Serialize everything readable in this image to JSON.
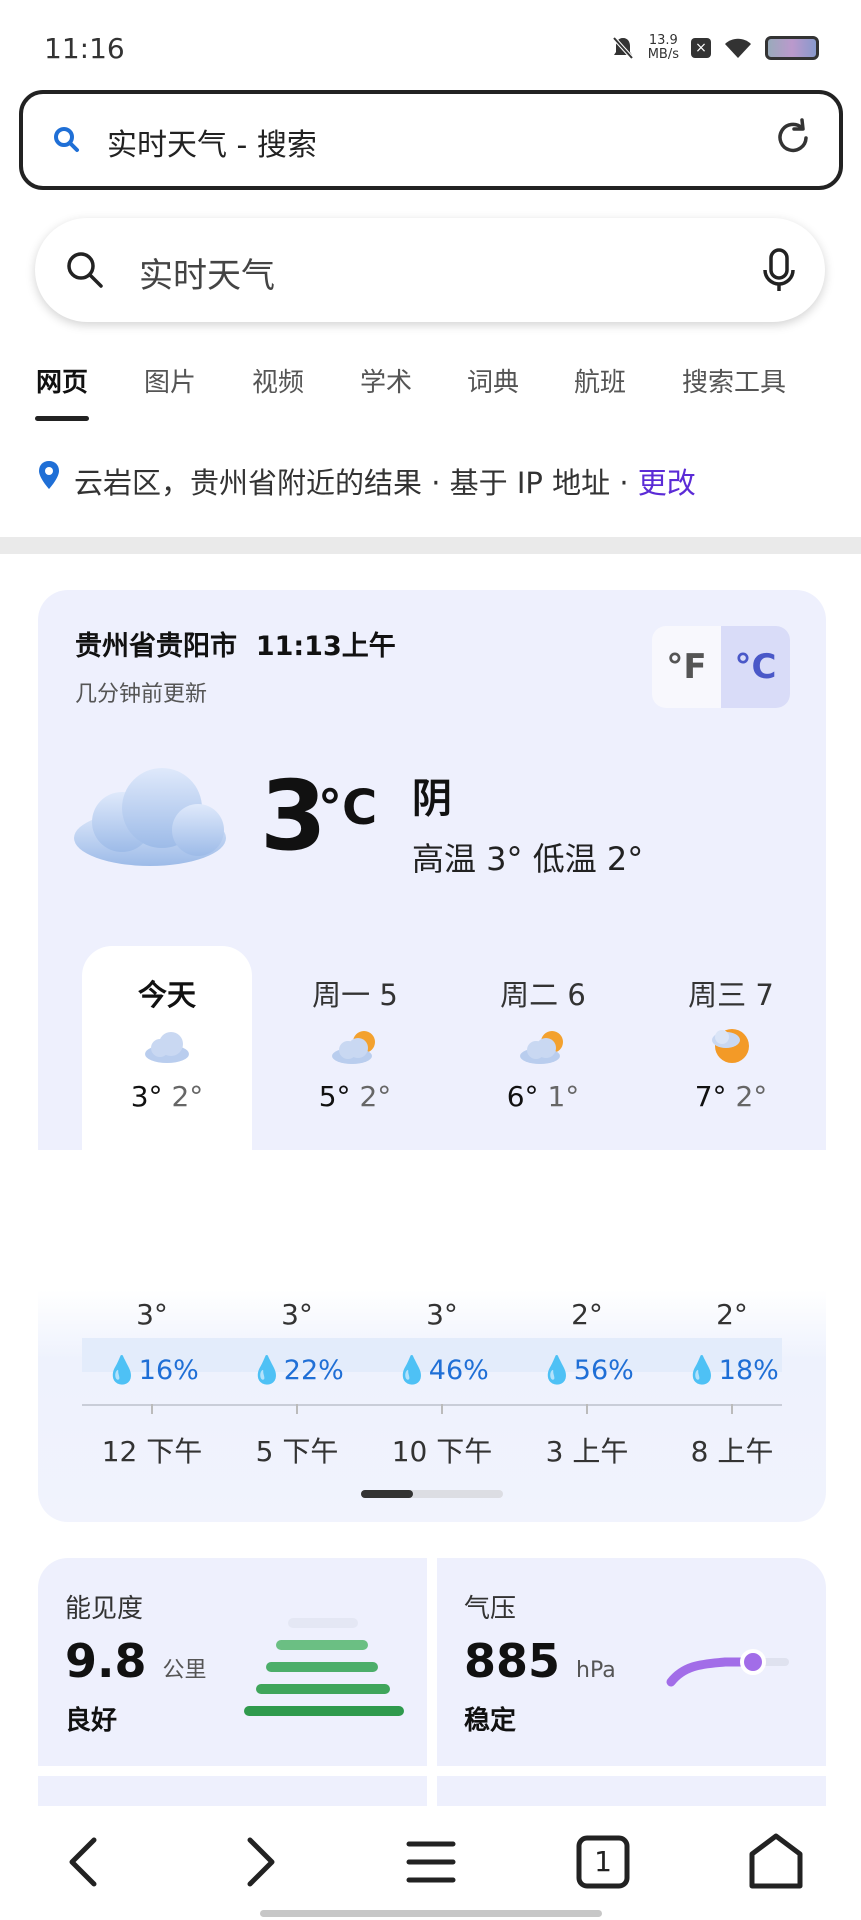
{
  "status_bar": {
    "time": "11:16",
    "net_speed_value": "13.9",
    "net_speed_unit": "MB/s"
  },
  "address_bar": {
    "text": "实时天气 - 搜索",
    "search_icon": "search-icon",
    "reload_icon": "reload-icon"
  },
  "search_box": {
    "query": "实时天气",
    "search_icon": "search-icon",
    "mic_icon": "microphone-icon"
  },
  "tabs": [
    {
      "label": "网页",
      "active": true
    },
    {
      "label": "图片"
    },
    {
      "label": "视频"
    },
    {
      "label": "学术"
    },
    {
      "label": "词典"
    },
    {
      "label": "航班"
    },
    {
      "label": "搜索工具"
    }
  ],
  "location": {
    "text": "云岩区，贵州省附近的结果 · 基于 IP 地址 · ",
    "change": "更改"
  },
  "weather": {
    "place": "贵州省贵阳市",
    "time": "11:13上午",
    "updated": "几分钟前更新",
    "unit_f": "°F",
    "unit_c": "°C",
    "active_unit": "°C",
    "temp": "3",
    "temp_unit": "°C",
    "condition": "阴",
    "hilo": "高温 3°  低温 2°",
    "days": [
      {
        "label": "今天",
        "high": "3°",
        "low": "2°",
        "icon": "cloud-icon"
      },
      {
        "label": "周一 5",
        "high": "5°",
        "low": "2°",
        "icon": "partly-cloudy-icon"
      },
      {
        "label": "周二 6",
        "high": "6°",
        "low": "1°",
        "icon": "partly-cloudy-icon"
      },
      {
        "label": "周三 7",
        "high": "7°",
        "low": "2°",
        "icon": "sun-cloud-icon"
      }
    ],
    "hourly": [
      {
        "temp": "3°",
        "precip": "16%",
        "time": "12 下午"
      },
      {
        "temp": "3°",
        "precip": "22%",
        "time": "5 下午"
      },
      {
        "temp": "3°",
        "precip": "46%",
        "time": "10 下午"
      },
      {
        "temp": "2°",
        "precip": "56%",
        "time": "3 上午"
      },
      {
        "temp": "2°",
        "precip": "18%",
        "time": "8 上午"
      }
    ]
  },
  "visibility": {
    "label": "能见度",
    "value": "9.8",
    "unit": "公里",
    "status": "良好",
    "color": "#3fa55b"
  },
  "pressure": {
    "label": "气压",
    "value": "885",
    "unit": "hPa",
    "status": "稳定",
    "color": "#a26de8"
  },
  "bottom_nav": {
    "tab_count": "1",
    "icons": [
      "back-icon",
      "forward-icon",
      "menu-icon",
      "tabs-icon",
      "home-icon"
    ]
  },
  "colors": {
    "accent_link": "#5b2bd6",
    "card_bg": "#eef0fd",
    "precip_blue": "#1f6fd6"
  }
}
